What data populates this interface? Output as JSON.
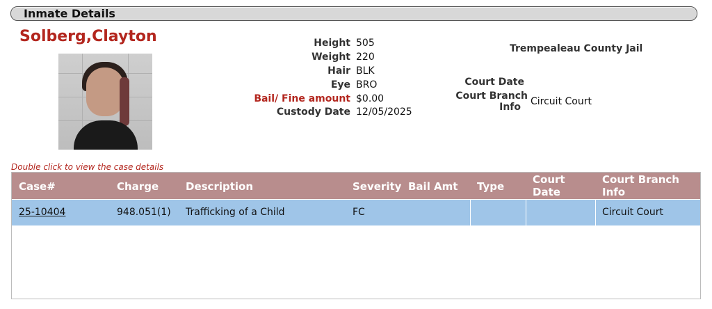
{
  "header": {
    "title": "Inmate Details"
  },
  "inmate": {
    "name": "Solberg,Clayton",
    "details": [
      {
        "label": "Height",
        "value": "505",
        "red": false
      },
      {
        "label": "Weight",
        "value": "220",
        "red": false
      },
      {
        "label": "Hair",
        "value": "BLK",
        "red": false
      },
      {
        "label": "Eye",
        "value": "BRO",
        "red": false
      },
      {
        "label": "Bail/ Fine amount",
        "value": "$0.00",
        "red": true
      },
      {
        "label": "Custody Date",
        "value": "12/05/2025",
        "red": false
      }
    ]
  },
  "facility": {
    "jail_name": "Trempealeau County Jail",
    "court_date_label": "Court Date",
    "court_branch_label_line1": "Court Branch",
    "court_branch_label_line2": "Info",
    "court_branch_value": "Circuit Court"
  },
  "hint": "Double click to view the case details",
  "table": {
    "headers": {
      "case": "Case#",
      "charge": "Charge",
      "description": "Description",
      "severity": "Severity",
      "bail_amt": "Bail Amt",
      "type": "Type",
      "court_date_1": "Court",
      "court_date_2": "Date",
      "court_branch_1": "Court Branch",
      "court_branch_2": "Info"
    },
    "rows": [
      {
        "case": "25-10404",
        "charge": "948.051(1)",
        "description": "Trafficking of a Child",
        "severity": "FC",
        "bail_amt": "",
        "type": "",
        "court_date": "",
        "court_branch": "Circuit Court"
      }
    ]
  },
  "colors": {
    "accent_red": "#b3261e",
    "table_header_bg": "#b88d8d",
    "row_highlight": "#9fc5e8"
  }
}
